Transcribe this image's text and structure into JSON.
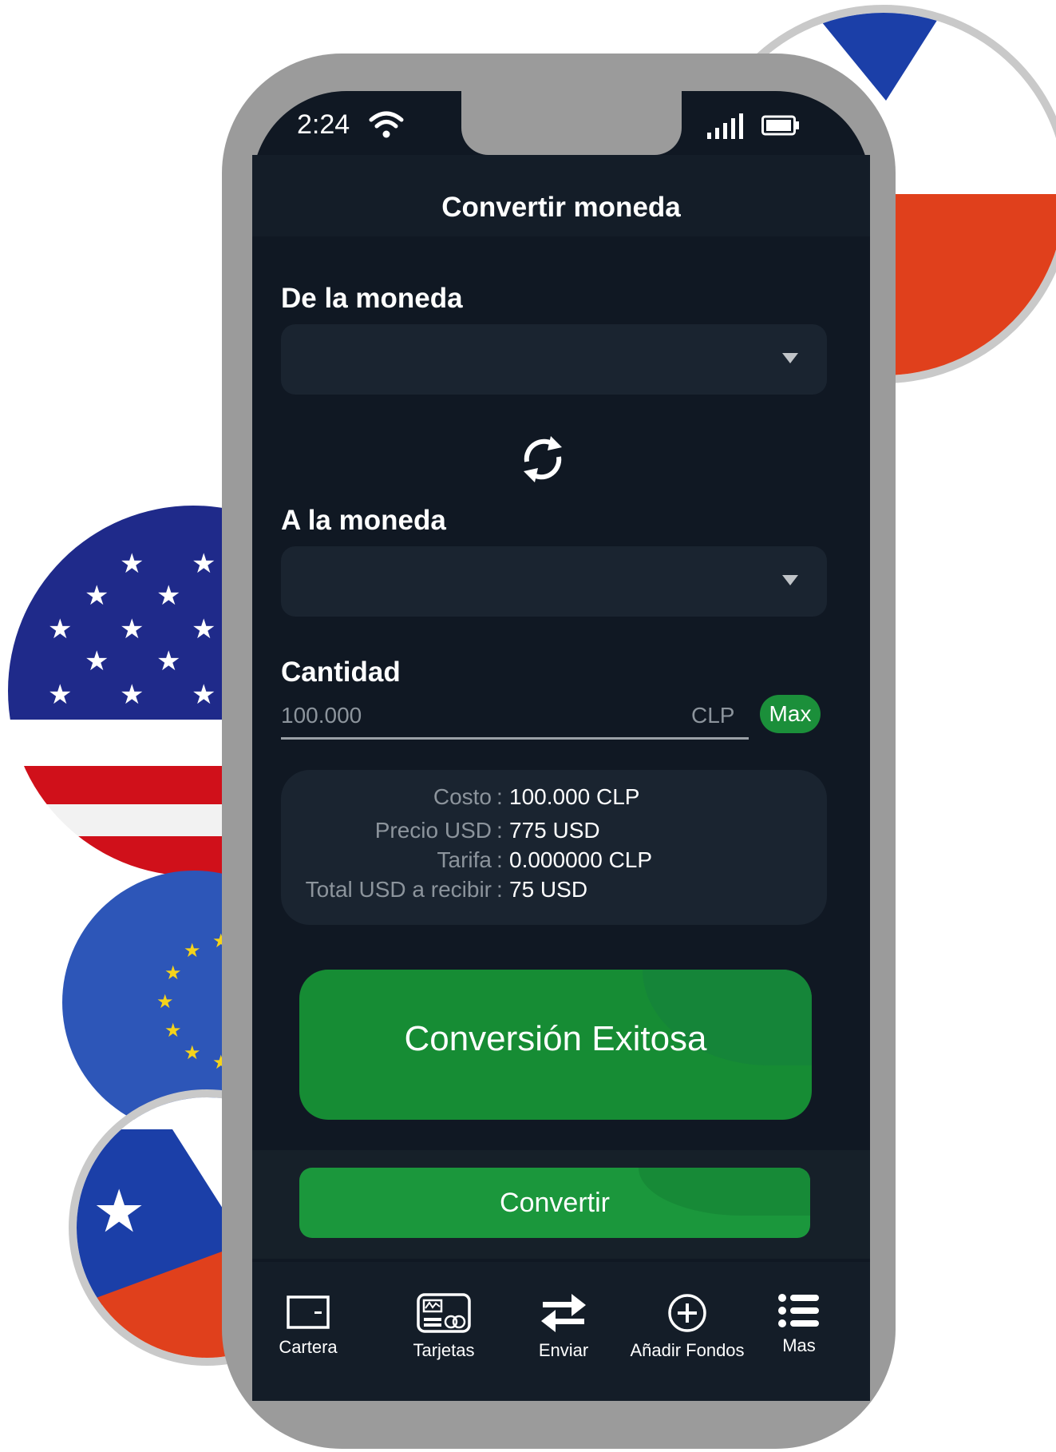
{
  "status_bar": {
    "time": "2:24"
  },
  "header": {
    "title": "Convertir moneda"
  },
  "from_currency": {
    "label": "De la moneda",
    "value": ""
  },
  "to_currency": {
    "label": "A la moneda",
    "value": ""
  },
  "amount": {
    "label": "Cantidad",
    "placeholder": "100.000",
    "currency": "CLP",
    "max_label": "Max"
  },
  "summary": [
    {
      "key": "Costo",
      "value": "100.000 CLP"
    },
    {
      "key": "Precio USD",
      "value": "775 USD"
    },
    {
      "key": "Tarifa",
      "value": "0.000000 CLP"
    },
    {
      "key": "Total USD a recibir",
      "value": "75 USD"
    }
  ],
  "toast": {
    "message": "Conversión Exitosa"
  },
  "convert_button": {
    "label": "Convertir"
  },
  "bottom_nav": [
    {
      "label": "Cartera",
      "icon": "wallet-icon"
    },
    {
      "label": "Tarjetas",
      "icon": "card-icon"
    },
    {
      "label": "Enviar",
      "icon": "transfer-arrows-icon"
    },
    {
      "label": "Añadir Fondos",
      "icon": "plus-circle-icon"
    },
    {
      "label": "Mas",
      "icon": "menu-list-icon"
    }
  ],
  "colors": {
    "accent_green": "#1b973c",
    "background": "#101823",
    "card": "#1a2430"
  }
}
